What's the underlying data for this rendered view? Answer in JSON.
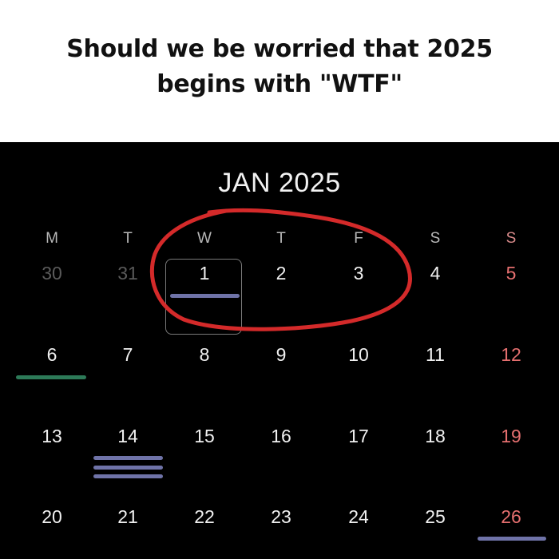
{
  "caption": {
    "line1": "Should we be worried that 2025",
    "line2": "begins with \"WTF\""
  },
  "calendar": {
    "month_title": "JAN 2025",
    "weekdays": [
      "M",
      "T",
      "W",
      "T",
      "F",
      "S",
      "S"
    ],
    "weeks": [
      [
        "30",
        "31",
        "1",
        "2",
        "3",
        "4",
        "5"
      ],
      [
        "6",
        "7",
        "8",
        "9",
        "10",
        "11",
        "12"
      ],
      [
        "13",
        "14",
        "15",
        "16",
        "17",
        "18",
        "19"
      ],
      [
        "20",
        "21",
        "22",
        "23",
        "24",
        "25",
        "26"
      ]
    ],
    "today": "1",
    "colors": {
      "background": "#000000",
      "day_text": "#f0f0f0",
      "muted_text": "#5a5a5a",
      "sunday_text": "#e56f6f",
      "annotation_circle": "#d42a2a",
      "event_blue": "#6f73a8",
      "event_green": "#2d7a58"
    }
  }
}
